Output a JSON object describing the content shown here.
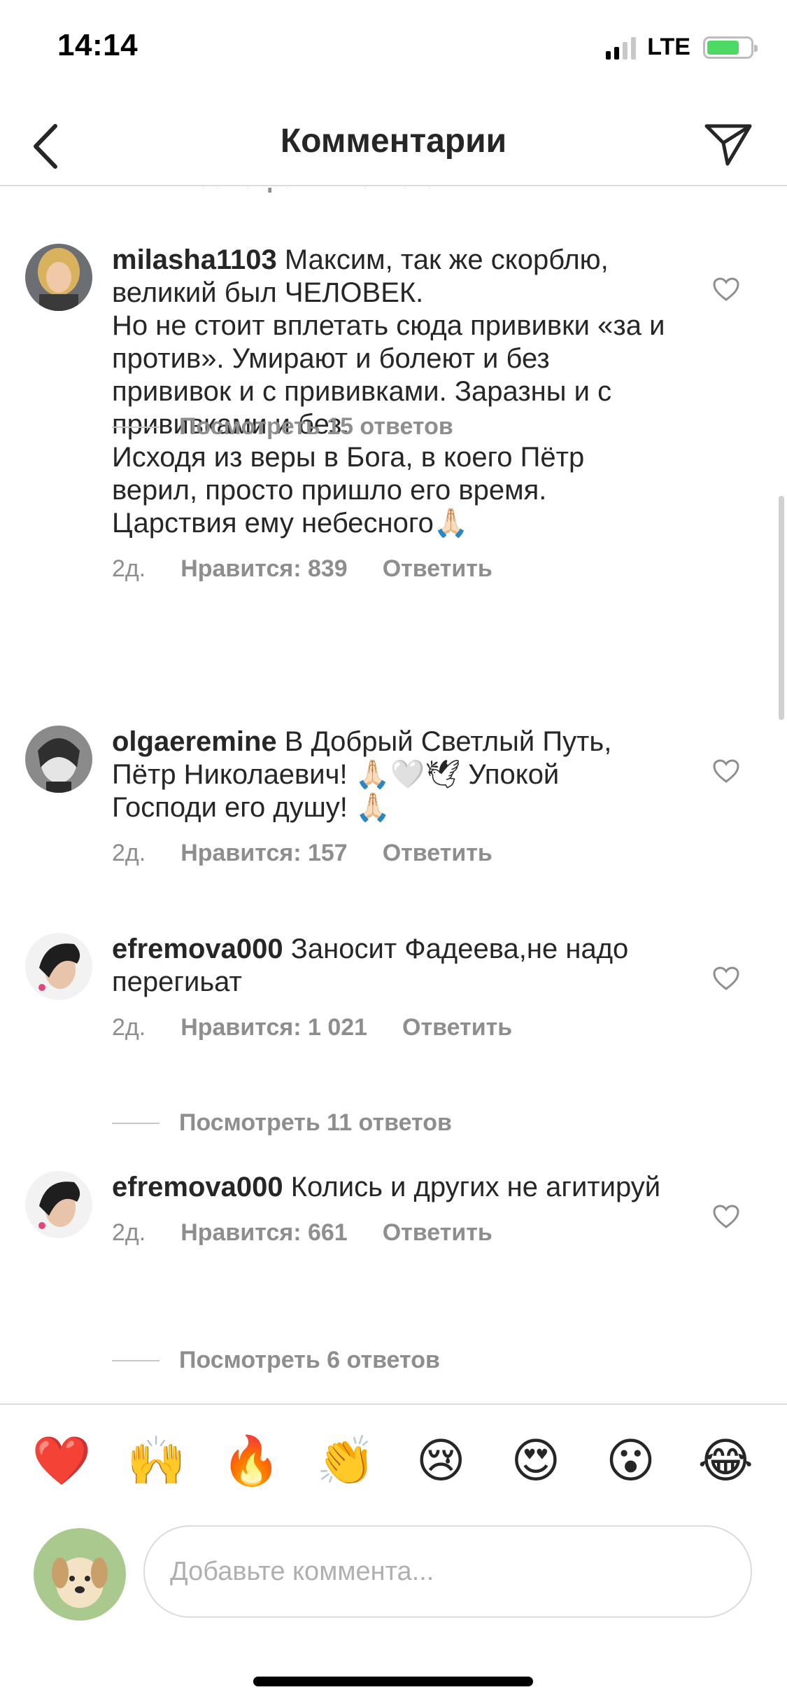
{
  "status_bar": {
    "time": "14:14",
    "network": "LTE"
  },
  "header": {
    "title": "Комментарии"
  },
  "partial_replies_link": "Посмотреть 11 ответов",
  "comments": [
    {
      "username": "milasha1103",
      "text": "Максим, так же скорблю, великий был ЧЕЛОВЕК.\nНо не стоит вплетать сюда прививки «за и против». Умирают и болеют и без прививок и с прививками. Заразны и с прививками и без.\nИсходя из веры в Бога, в коего Пётр верил, просто пришло его время. Царствия ему небесного🙏🏻",
      "time": "2д.",
      "likes": "Нравится: 839",
      "reply": "Ответить",
      "replies_link": "Посмотреть 15 ответов"
    },
    {
      "username": "olgaeremine",
      "text": "В Добрый Светлый Путь, Пётр Николаевич! 🙏🏻🤍🕊 Упокой Господи его душу! 🙏🏻",
      "time": "2д.",
      "likes": "Нравится: 157",
      "reply": "Ответить",
      "replies_link": ""
    },
    {
      "username": "efremova000",
      "text": "Заносит Фадеева,не надо перегиьат",
      "time": "2д.",
      "likes": "Нравится: 1 021",
      "reply": "Ответить",
      "replies_link": "Посмотреть 11 ответов"
    },
    {
      "username": "efremova000",
      "text": "Колись и других не агитируй",
      "time": "2д.",
      "likes": "Нравится: 661",
      "reply": "Ответить",
      "replies_link": "Посмотреть 6 ответов"
    }
  ],
  "reactions": [
    "❤️",
    "🙌",
    "🔥",
    "👏",
    "😢",
    "😍",
    "😮",
    "😂"
  ],
  "input": {
    "placeholder": "Добавьте коммента..."
  }
}
